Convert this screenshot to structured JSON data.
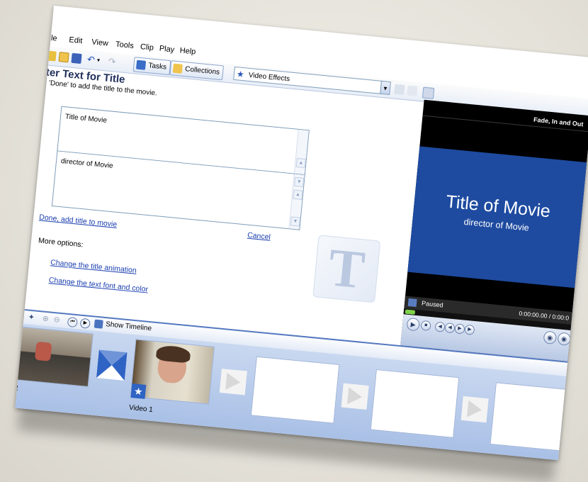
{
  "menu": [
    "ile",
    "Edit",
    "View",
    "Tools",
    "Clip",
    "Play",
    "Help"
  ],
  "toolbar": {
    "tasks_label": "Tasks",
    "collections_label": "Collections",
    "video_effects_label": "Video Effects"
  },
  "task": {
    "title": "ter Text for Title",
    "subtitle": ": 'Done' to add the title to the movie."
  },
  "title_box_text": "Title of Movie",
  "subtitle_box_text": "director of Movie",
  "links": {
    "done": "Done, add title to movie",
    "cancel": "Cancel",
    "more_options": "More options:",
    "change_animation": "Change the title animation",
    "change_font": "Change the text font and color"
  },
  "player": {
    "effect_name": "Fade, In and Out",
    "movie_title": "Title of Movie",
    "movie_subtitle": "director of Movie",
    "status": "Paused",
    "time": "0:00:00.00 / 0:00:0"
  },
  "timeline": {
    "show_timeline_label": "Show Timeline",
    "clip1_caption": "2",
    "clip2_caption": "Video 1"
  },
  "icons": {
    "big_letter": "T",
    "pin": "pin-icon",
    "zoom_in": "zoom-in-icon",
    "zoom_out": "zoom-out-icon",
    "rewind": "rewind-icon",
    "play": "play-icon",
    "star": "star-icon"
  },
  "colors": {
    "accent": "#1e4ba0",
    "link": "#1b3fb0",
    "storyboard": "#b8cbec"
  }
}
